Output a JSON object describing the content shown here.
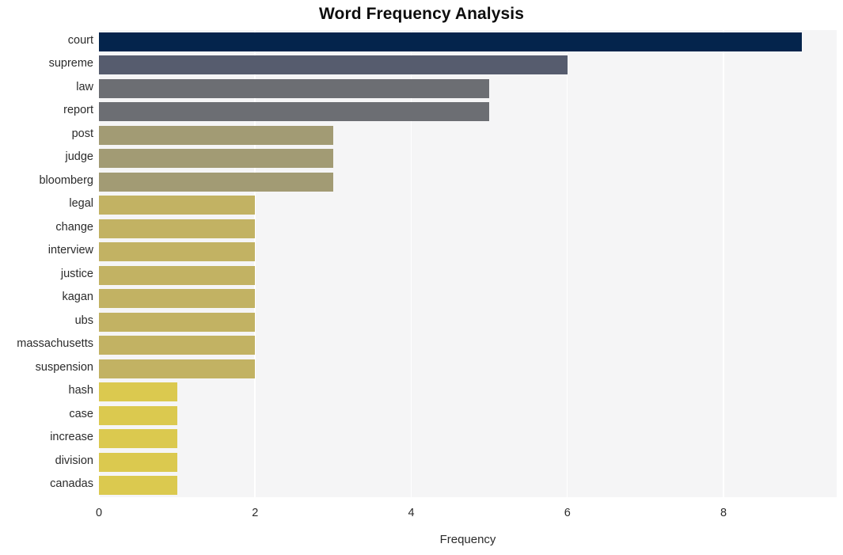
{
  "chart_data": {
    "type": "bar",
    "orientation": "horizontal",
    "title": "Word Frequency Analysis",
    "xlabel": "Frequency",
    "ylabel": "",
    "categories": [
      "court",
      "supreme",
      "law",
      "report",
      "post",
      "judge",
      "bloomberg",
      "legal",
      "change",
      "interview",
      "justice",
      "kagan",
      "ubs",
      "massachusetts",
      "suspension",
      "hash",
      "case",
      "increase",
      "division",
      "canadas"
    ],
    "values": [
      9,
      6,
      5,
      5,
      3,
      3,
      3,
      2,
      2,
      2,
      2,
      2,
      2,
      2,
      2,
      1,
      1,
      1,
      1,
      1
    ],
    "bar_colors": [
      "#04244c",
      "#565c6e",
      "#6c6e73",
      "#6c6e73",
      "#a29b74",
      "#a29b74",
      "#a29b74",
      "#c2b263",
      "#c2b263",
      "#c2b263",
      "#c2b263",
      "#c2b263",
      "#c2b263",
      "#c2b263",
      "#c2b263",
      "#dbc94f",
      "#dbc94f",
      "#dbc94f",
      "#dbc94f",
      "#dbc94f"
    ],
    "xlim": [
      0,
      9.45
    ],
    "xticks": [
      0,
      2,
      4,
      6,
      8
    ],
    "xtick_labels": [
      "0",
      "2",
      "4",
      "6",
      "8"
    ],
    "grid": "vertical",
    "legend": "none",
    "plot_background": "#f5f5f6",
    "gridline_color": "#ffffff",
    "figure_background": "#ffffff",
    "title_color": "#0d0d0d",
    "tick_label_color": "#2b2b2b"
  }
}
